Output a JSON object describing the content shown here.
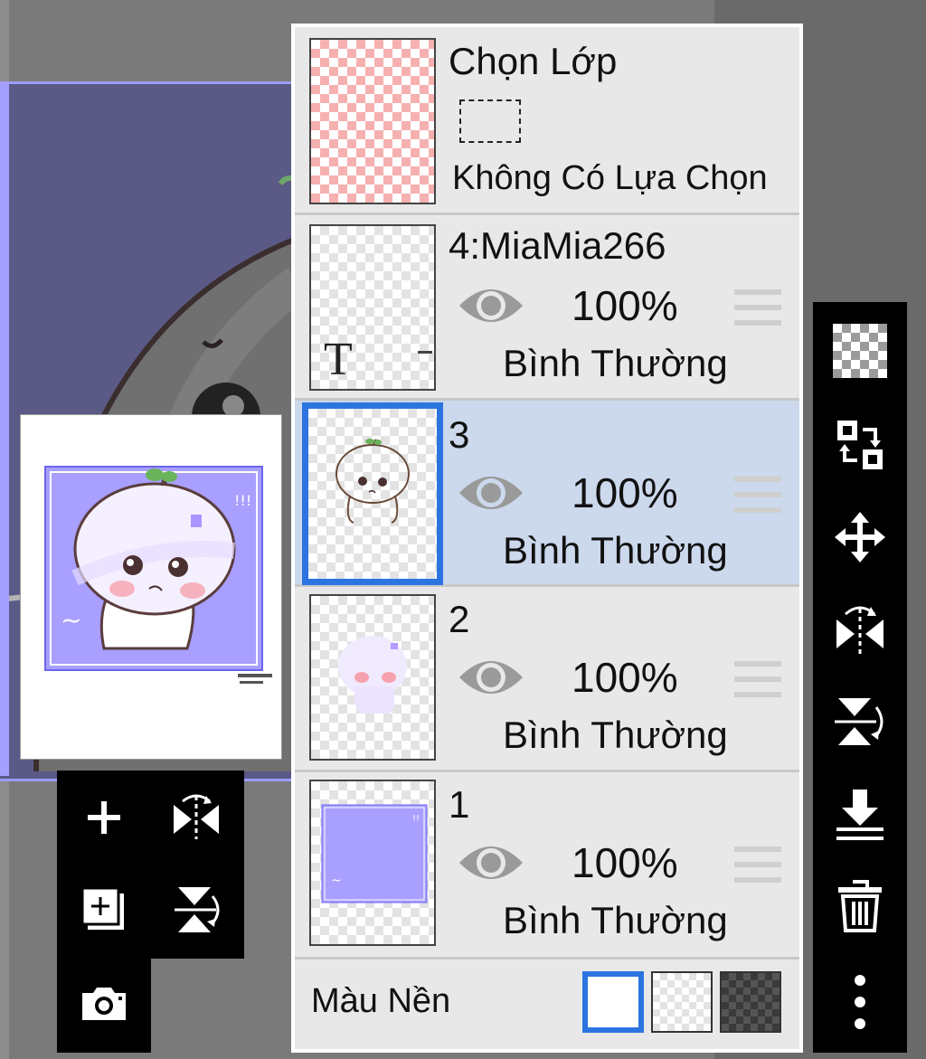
{
  "selection_row": {
    "title": "Chọn Lớp",
    "status": "Không Có Lựa Chọn"
  },
  "layers": [
    {
      "name": "4:MiaMia266",
      "opacity": "100%",
      "blend": "Bình Thường",
      "selected": false,
      "thumb_type": "text",
      "thumb_letter": "T"
    },
    {
      "name": "3",
      "opacity": "100%",
      "blend": "Bình Thường",
      "selected": true,
      "thumb_type": "lineart"
    },
    {
      "name": "2",
      "opacity": "100%",
      "blend": "Bình Thường",
      "selected": false,
      "thumb_type": "color"
    },
    {
      "name": "1",
      "opacity": "100%",
      "blend": "Bình Thường",
      "selected": false,
      "thumb_type": "background"
    }
  ],
  "background_color": {
    "label": "Màu Nền",
    "options": [
      "white",
      "transparent",
      "dark-checker"
    ],
    "selected": "white"
  },
  "colors": {
    "accent": "#2c74e0",
    "selected_row": "#ccd8ec",
    "panel": "#e8e8e8",
    "art_purple": "#a39fff"
  },
  "left_tools": [
    "add-layer-icon",
    "flip-horizontal-icon",
    "add-copy-icon",
    "flip-vertical-icon",
    "camera-icon"
  ],
  "right_tools": [
    "transparency-icon",
    "swap-icon",
    "move-icon",
    "flip-horizontal-icon",
    "flip-vertical-icon",
    "merge-down-icon",
    "trash-icon",
    "more-icon"
  ]
}
